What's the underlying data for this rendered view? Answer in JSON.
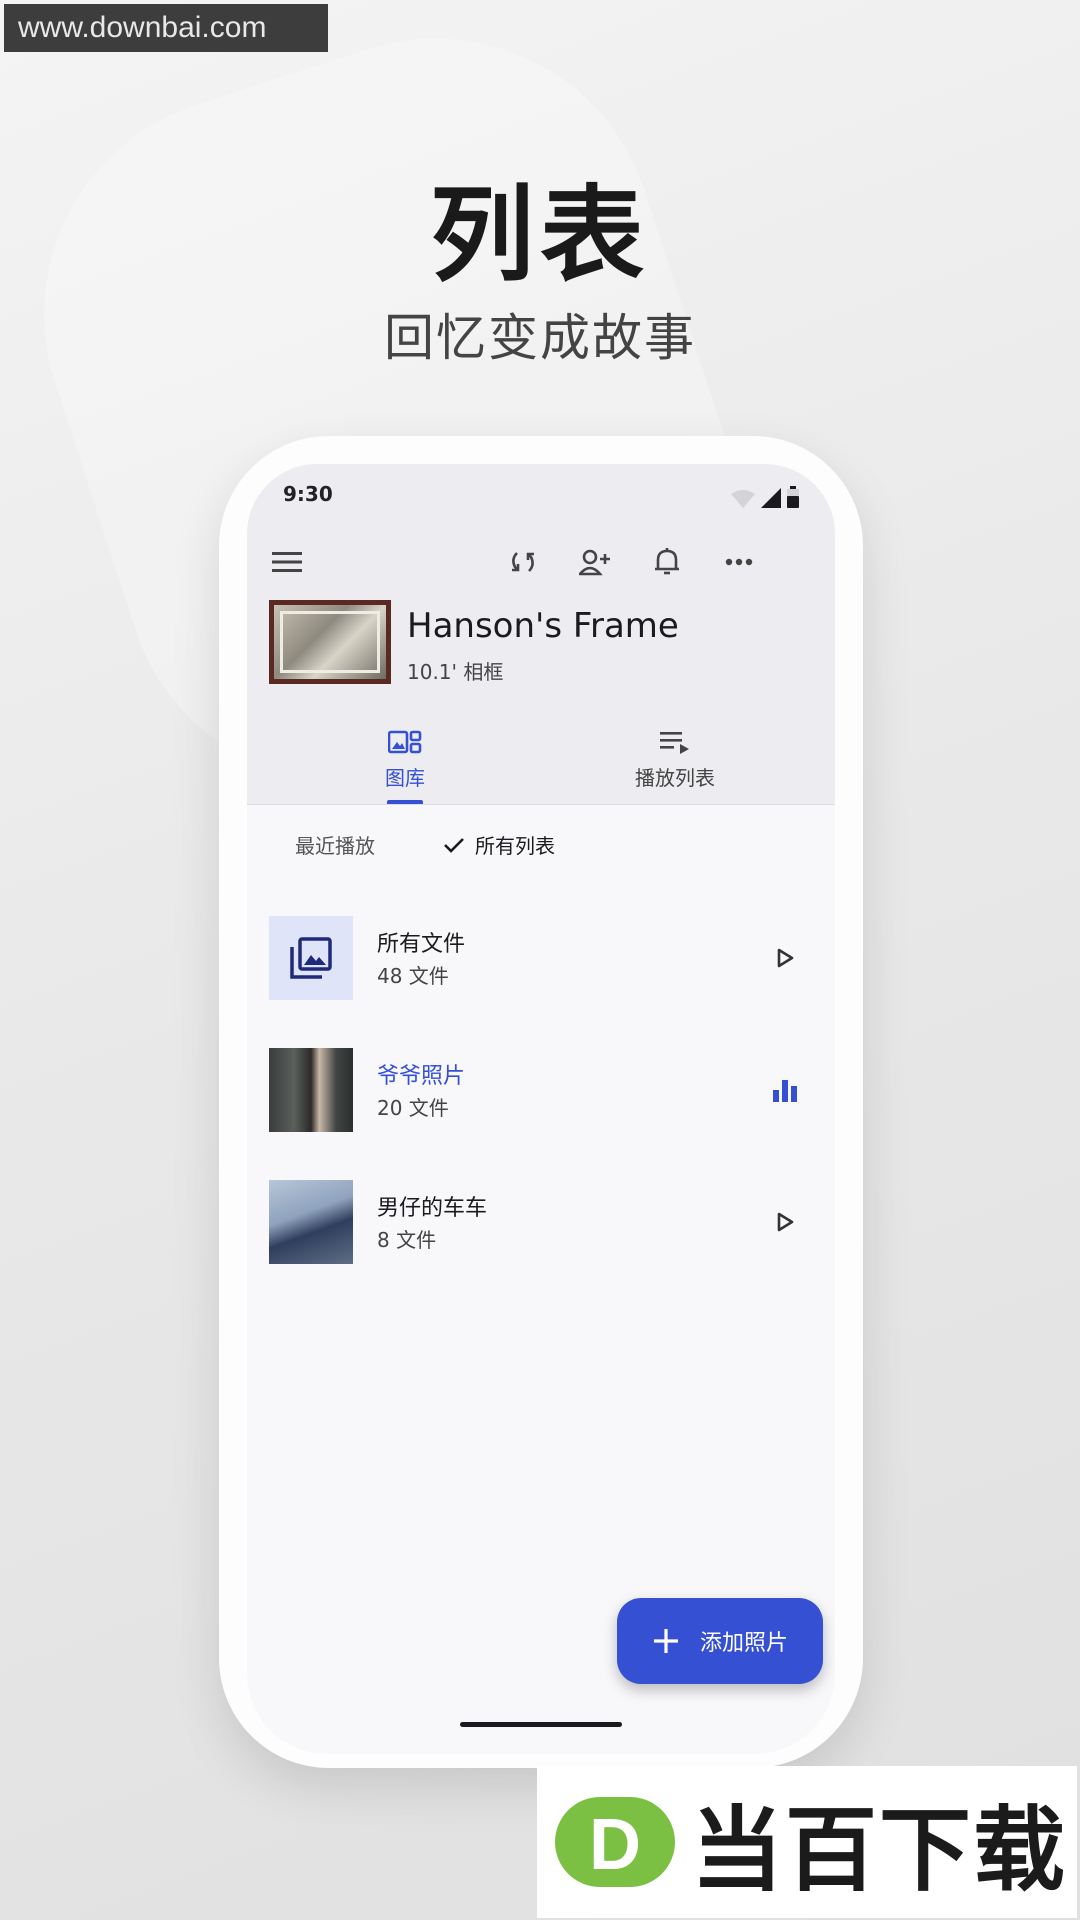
{
  "watermark": "www.downbai.com",
  "hero": {
    "title": "列表",
    "subtitle": "回忆变成故事"
  },
  "status_bar": {
    "time": "9:30"
  },
  "device": {
    "name": "Hanson's Frame",
    "size": "10.1' 相框"
  },
  "tabs": [
    {
      "label": "图库",
      "icon": "gallery-icon",
      "active": true
    },
    {
      "label": "播放列表",
      "icon": "playlist-icon",
      "active": false
    }
  ],
  "filters": {
    "recent": "最近播放",
    "all": "所有列表",
    "selected": "all"
  },
  "playlists": [
    {
      "title": "所有文件",
      "count": "48 文件",
      "action": "play-icon",
      "playing": false
    },
    {
      "title": "爷爷照片",
      "count": "20 文件",
      "action": "now-playing-icon",
      "playing": true
    },
    {
      "title": "男仔的车车",
      "count": "8 文件",
      "action": "play-icon",
      "playing": false
    }
  ],
  "fab": {
    "label": "添加照片"
  },
  "brand": {
    "name": "当百下载",
    "logo_letter": "D"
  },
  "colors": {
    "accent": "#3550d3",
    "text": "#1b1b1f",
    "frame_border": "#5a2a22",
    "brand_green": "#7cc043"
  }
}
